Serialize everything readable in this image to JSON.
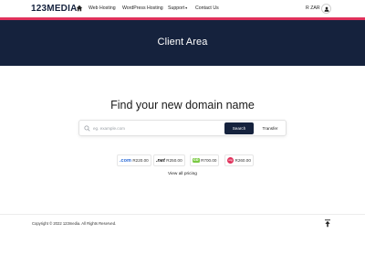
{
  "nav": {
    "brand": "123MEDIA",
    "home_icon": "home-icon",
    "links": [
      {
        "label": "Web Hosting"
      },
      {
        "label": "WordPress Hosting"
      },
      {
        "label": "Support"
      },
      {
        "label": "Contact Us"
      }
    ],
    "currency": "R ZAR",
    "user_icon": "user-icon",
    "accent_color": "#e0315b"
  },
  "hero": {
    "title": "Client Area",
    "background": "#15223d"
  },
  "domain_search": {
    "heading": "Find your new domain name",
    "placeholder": "eg. example.com",
    "search_label": "Search",
    "transfer_label": "Transfer"
  },
  "tlds": [
    {
      "logo": ".com",
      "price": "R220.00",
      "color": "#2a6ad6"
    },
    {
      "logo": ".net",
      "price": "R250.00",
      "color": "#111111"
    },
    {
      "logo": "co",
      "price": "R700.00",
      "color": "#7ac943"
    },
    {
      "logo": "org",
      "price": "R260.00",
      "color": "#e0315b"
    }
  ],
  "view_pricing": "View all pricing",
  "footer": {
    "copyright": "Copyright © 2022 123media. All Rights Reserved.",
    "to_top_icon": "arrow-up-to-top-icon"
  }
}
